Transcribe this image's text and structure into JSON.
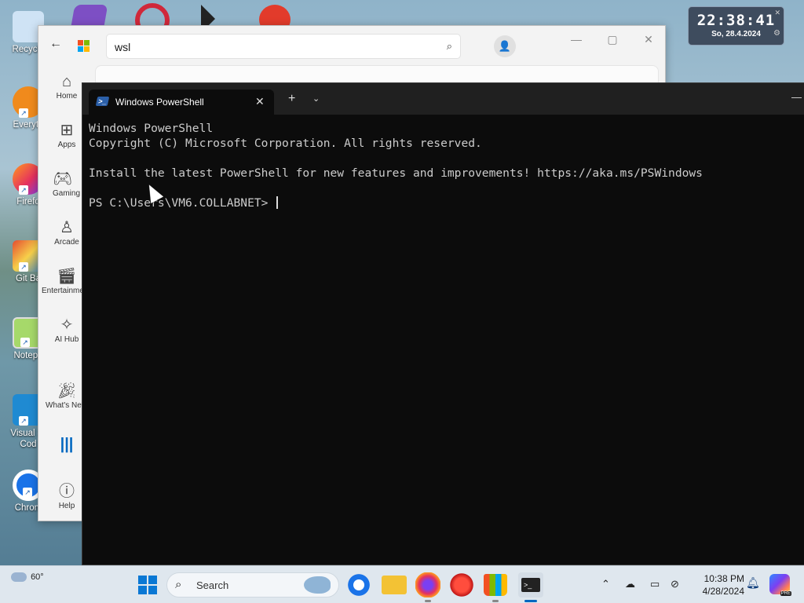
{
  "desktop": {
    "icons": [
      {
        "label": "Recycle",
        "icon": "recycle-bin-icon"
      },
      {
        "label": "Everyth",
        "icon": "everything-search-icon"
      },
      {
        "label": "Firefo",
        "icon": "firefox-icon"
      },
      {
        "label": "Git Ba",
        "icon": "git-bash-icon"
      },
      {
        "label": "Notepa",
        "icon": "notepad-icon"
      },
      {
        "label": "Visual St Cod",
        "icon": "vscode-icon"
      },
      {
        "label": "Chrom",
        "icon": "chrome-icon"
      }
    ]
  },
  "clock_widget": {
    "time": "22:38:41",
    "date": "So, 28.4.2024"
  },
  "store": {
    "search_value": "wsl",
    "nav": [
      {
        "label": "Home",
        "icon": "home-icon"
      },
      {
        "label": "Apps",
        "icon": "apps-icon"
      },
      {
        "label": "Gaming",
        "icon": "gamepad-icon"
      },
      {
        "label": "Arcade",
        "icon": "joystick-icon"
      },
      {
        "label": "Entertainment",
        "icon": "clapperboard-icon"
      },
      {
        "label": "AI Hub",
        "icon": "sparkle-icon"
      },
      {
        "label": "What's New",
        "icon": "party-icon"
      },
      {
        "label": "",
        "icon": "library-icon"
      },
      {
        "label": "Help",
        "icon": "help-icon"
      }
    ]
  },
  "terminal": {
    "tab_title": "Windows PowerShell",
    "lines": [
      "Windows PowerShell",
      "Copyright (C) Microsoft Corporation. All rights reserved.",
      "",
      "Install the latest PowerShell for new features and improvements! https://aka.ms/PSWindows",
      ""
    ],
    "prompt": "PS C:\\Users\\VM6.COLLABNET> "
  },
  "taskbar": {
    "weather_temp": "60°",
    "search_label": "Search",
    "time": "10:38 PM",
    "date": "4/28/2024"
  }
}
